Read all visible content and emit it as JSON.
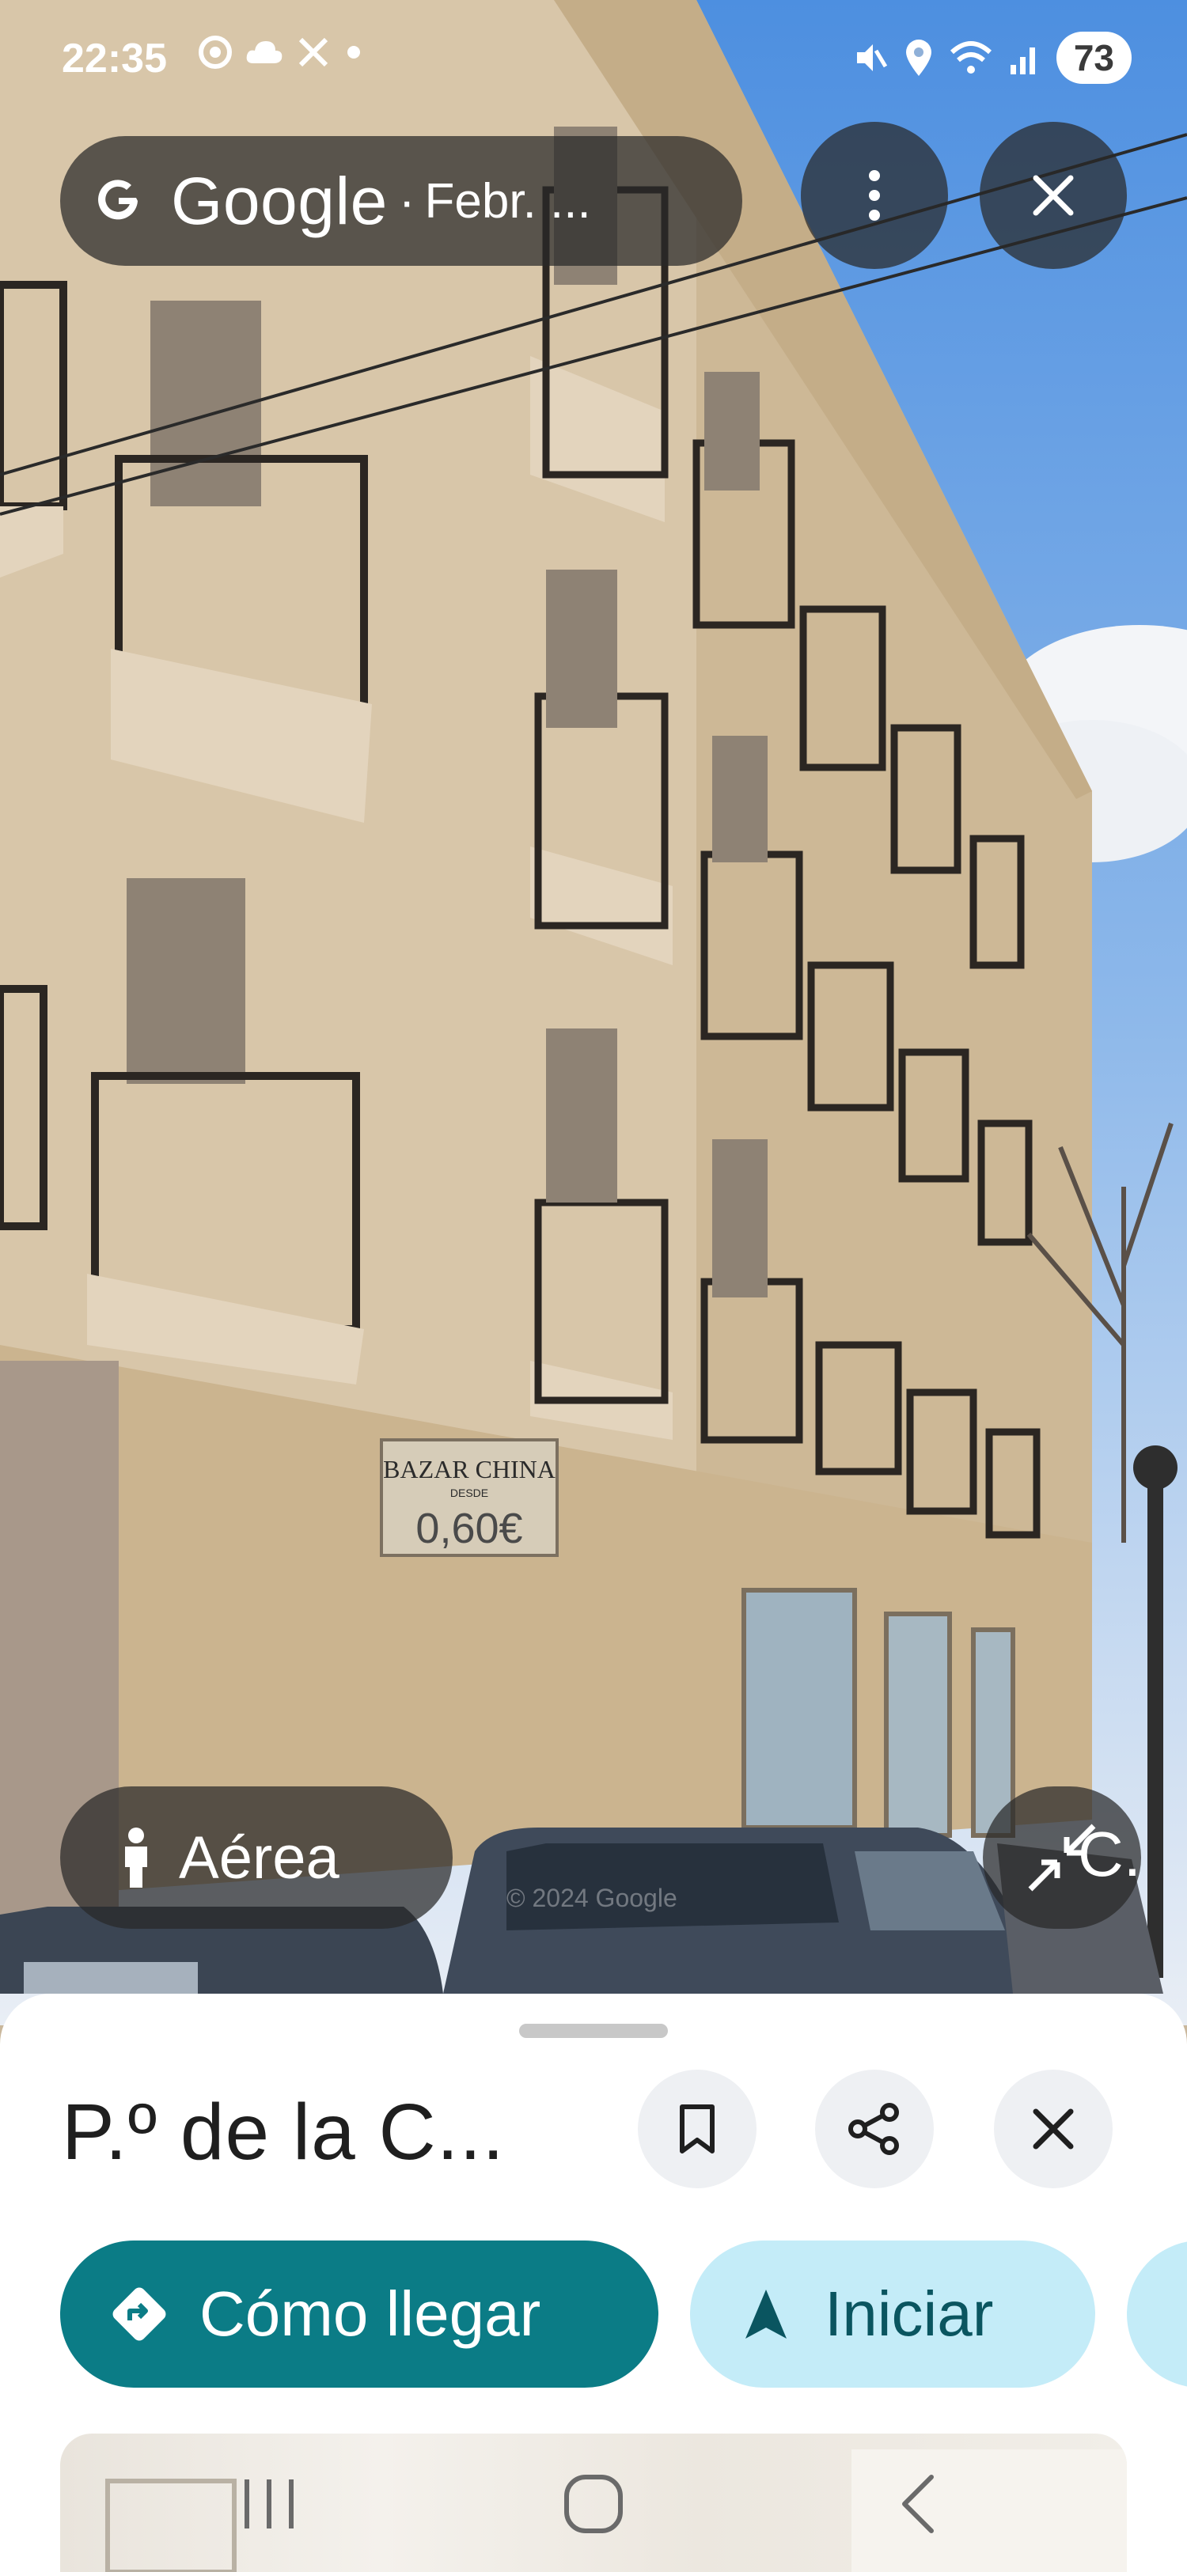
{
  "status_bar": {
    "time": "22:35",
    "left_icons": [
      "chrome-icon",
      "cloud-icon",
      "x-icon",
      "dot-icon"
    ],
    "right_icons": [
      "mute-icon",
      "location-icon",
      "wifi-icon",
      "signal-icon"
    ],
    "battery": "73"
  },
  "top_bar": {
    "brand": "Google",
    "separator": "·",
    "date": "Febr. ..."
  },
  "overlay": {
    "aerea_label": "Aérea",
    "street_label": "C."
  },
  "photo_text": {
    "shop_sign_line1": "BAZAR CHINA",
    "shop_sign_line2": "DESDE",
    "shop_sign_price": "0,60€",
    "watermark": "© 2024 Google"
  },
  "sheet": {
    "title": "P.º de la C...",
    "directions_label": "Cómo llegar",
    "start_label": "Iniciar"
  },
  "colors": {
    "primary": "#0b7c86",
    "secondary_button": "#c4ecf8",
    "overlay": "#282828"
  }
}
